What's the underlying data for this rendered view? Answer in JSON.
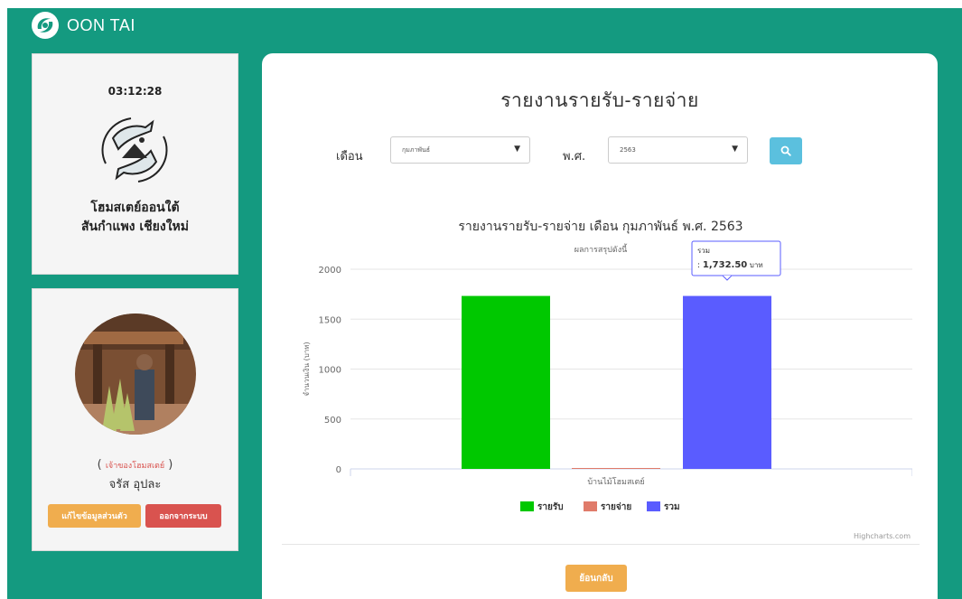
{
  "brand": {
    "name": "OON TAI",
    "logo_icon": "fish-logo-icon"
  },
  "sidebar": {
    "clock": "03:12:28",
    "homestay_name_line1": "โฮมสเตย์ออนใต้",
    "homestay_name_line2": "สันกำแพง เชียงใหม่",
    "role_open": "(",
    "role": "เจ้าของโฮมสเตย์",
    "role_close": ")",
    "user_name": "จรัส อุปละ",
    "edit_profile_label": "แก้ไขข้อมูลส่วนตัว",
    "logout_label": "ออกจากระบบ"
  },
  "main": {
    "title": "รายงานรายรับ-รายจ่าย",
    "month_label": "เดือน",
    "month_value": "กุมภาพันธ์",
    "year_label": "พ.ศ.",
    "year_value": "2563",
    "search_icon": "search-icon",
    "back_label": "ย้อนกลับ"
  },
  "colors": {
    "page_bg": "#149a80",
    "income": "#00c800",
    "expense": "#e07b6a",
    "total": "#5a5cff",
    "edit_button": "#f0ad4e",
    "logout_button": "#d9534f",
    "search_button": "#5bc0de"
  },
  "chart_data": {
    "type": "bar",
    "title": "รายงานรายรับ-รายจ่าย เดือน กุมภาพันธ์ พ.ศ. 2563",
    "subtitle": "ผลการสรุปดังนี้",
    "ylabel": "จำนวนเงิน (บาท)",
    "ylim": [
      0,
      2000
    ],
    "yticks": [
      0,
      500,
      1000,
      1500,
      2000
    ],
    "categories": [
      "บ้านไม้โฮมสเตย์"
    ],
    "series": [
      {
        "name": "รายรับ",
        "values": [
          1732.5
        ],
        "color": "#00c800"
      },
      {
        "name": "รายจ่าย",
        "values": [
          0
        ],
        "color": "#e07b6a"
      },
      {
        "name": "รวม",
        "values": [
          1732.5
        ],
        "color": "#5a5cff"
      }
    ],
    "tooltip": {
      "series": "รวม",
      "prefix": ": ",
      "value": "1,732.50",
      "unit": "บาท"
    },
    "legend": "bottom-center",
    "credits": "Highcharts.com",
    "grid": true
  }
}
